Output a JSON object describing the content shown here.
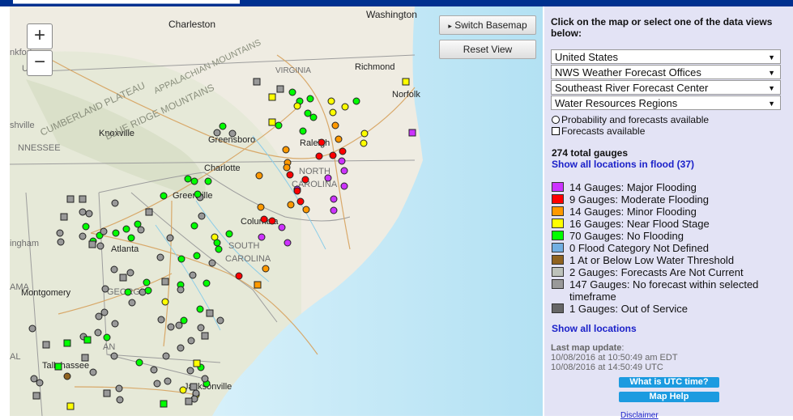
{
  "header": {
    "brand_color": "#00308f"
  },
  "map": {
    "colors": {
      "land": "#f2efe6",
      "ocean": "#c8eaf6",
      "roads": "#d7a25e",
      "state_border": "#9d9d9d",
      "text": "#222222"
    },
    "place_labels": [
      "Washington",
      "Charleston",
      "Richmond",
      "Norfolk",
      "Greensboro",
      "Raleigh",
      "Knoxville",
      "Charlotte",
      "Greenville",
      "Columbia",
      "Atlanta",
      "Montgomery",
      "Tallahassee",
      "Jacksonville",
      "NORTH",
      "CAROLINA",
      "SOUTH",
      "CAROLINA",
      "GEORGIA",
      "VIRGINIA",
      "CUMBERLAND PLATEAU",
      "BLUE RIDGE MOUNTAINS",
      "APPALACHIAN MOUNTAINS",
      "nkfort",
      "UCKY",
      "shville",
      "NNESSEE",
      "ingham",
      "AMA",
      "AL",
      "AN"
    ],
    "gauges": [
      {
        "cat": "yellow",
        "shape": "circle"
      },
      {
        "cat": "green",
        "shape": "circle"
      },
      {
        "cat": "green",
        "shape": "circle"
      },
      {
        "cat": "yellow",
        "shape": "square"
      },
      {
        "cat": "green",
        "shape": "circle"
      },
      {
        "cat": "yellow",
        "shape": "circle"
      },
      {
        "cat": "green",
        "shape": "circle"
      },
      {
        "cat": "yellow",
        "shape": "circle"
      },
      {
        "cat": "yellow",
        "shape": "circle"
      },
      {
        "cat": "yellow",
        "shape": "circle"
      },
      {
        "cat": "green",
        "shape": "circle"
      },
      {
        "cat": "yellow",
        "shape": "square"
      },
      {
        "cat": "green",
        "shape": "circle"
      },
      {
        "cat": "green",
        "shape": "circle"
      },
      {
        "cat": "green",
        "shape": "circle"
      },
      {
        "cat": "green",
        "shape": "circle"
      },
      {
        "cat": "orange",
        "shape": "circle"
      },
      {
        "cat": "orange",
        "shape": "circle"
      },
      {
        "cat": "red",
        "shape": "circle"
      },
      {
        "cat": "red",
        "shape": "circle"
      },
      {
        "cat": "red",
        "shape": "circle"
      },
      {
        "cat": "yellow",
        "shape": "circle"
      },
      {
        "cat": "yellow",
        "shape": "circle"
      },
      {
        "cat": "gray",
        "shape": "circle"
      },
      {
        "cat": "gray",
        "shape": "circle"
      },
      {
        "cat": "green",
        "shape": "circle"
      },
      {
        "cat": "orange",
        "shape": "circle"
      },
      {
        "cat": "orange",
        "shape": "circle"
      },
      {
        "cat": "orange",
        "shape": "circle"
      },
      {
        "cat": "red",
        "shape": "circle"
      },
      {
        "cat": "red",
        "shape": "circle"
      },
      {
        "cat": "red",
        "shape": "circle"
      },
      {
        "cat": "purple",
        "shape": "circle"
      },
      {
        "cat": "purple",
        "shape": "circle"
      },
      {
        "cat": "purple",
        "shape": "circle"
      },
      {
        "cat": "purple",
        "shape": "circle"
      },
      {
        "cat": "orange",
        "shape": "circle"
      },
      {
        "cat": "purple",
        "shape": "circle"
      },
      {
        "cat": "red",
        "shape": "circle"
      },
      {
        "cat": "red",
        "shape": "circle"
      },
      {
        "cat": "purple",
        "shape": "circle"
      },
      {
        "cat": "orange",
        "shape": "circle"
      },
      {
        "cat": "orange",
        "shape": "circle"
      },
      {
        "cat": "orange",
        "shape": "circle"
      },
      {
        "cat": "red",
        "shape": "circle"
      },
      {
        "cat": "red",
        "shape": "circle"
      },
      {
        "cat": "purple",
        "shape": "circle"
      },
      {
        "cat": "purple",
        "shape": "circle"
      },
      {
        "cat": "purple",
        "shape": "circle"
      },
      {
        "cat": "purple",
        "shape": "circle"
      },
      {
        "cat": "orange",
        "shape": "circle"
      },
      {
        "cat": "red",
        "shape": "circle"
      },
      {
        "cat": "orange",
        "shape": "square"
      },
      {
        "cat": "purple",
        "shape": "square"
      },
      {
        "cat": "yellow",
        "shape": "square"
      },
      {
        "cat": "green",
        "shape": "circle"
      },
      {
        "cat": "green",
        "shape": "circle"
      },
      {
        "cat": "green",
        "shape": "circle"
      },
      {
        "cat": "gray",
        "shape": "circle"
      },
      {
        "cat": "green",
        "shape": "circle"
      },
      {
        "cat": "green",
        "shape": "circle"
      },
      {
        "cat": "green",
        "shape": "circle"
      },
      {
        "cat": "gray",
        "shape": "circle"
      },
      {
        "cat": "green",
        "shape": "circle"
      },
      {
        "cat": "yellow",
        "shape": "circle"
      },
      {
        "cat": "green",
        "shape": "circle"
      },
      {
        "cat": "green",
        "shape": "circle"
      },
      {
        "cat": "green",
        "shape": "circle"
      },
      {
        "cat": "gray",
        "shape": "circle"
      },
      {
        "cat": "green",
        "shape": "circle"
      },
      {
        "cat": "green",
        "shape": "circle"
      },
      {
        "cat": "green",
        "shape": "circle"
      },
      {
        "cat": "green",
        "shape": "circle"
      },
      {
        "cat": "gray",
        "shape": "circle"
      },
      {
        "cat": "gray",
        "shape": "square"
      },
      {
        "cat": "gray",
        "shape": "square"
      },
      {
        "cat": "gray",
        "shape": "circle"
      },
      {
        "cat": "gray",
        "shape": "circle"
      },
      {
        "cat": "gray",
        "shape": "circle"
      },
      {
        "cat": "gray",
        "shape": "square"
      },
      {
        "cat": "gray",
        "shape": "circle"
      },
      {
        "cat": "green",
        "shape": "circle"
      },
      {
        "cat": "green",
        "shape": "circle"
      },
      {
        "cat": "green",
        "shape": "circle"
      },
      {
        "cat": "gray",
        "shape": "circle"
      },
      {
        "cat": "gray",
        "shape": "circle"
      },
      {
        "cat": "green",
        "shape": "circle"
      },
      {
        "cat": "green",
        "shape": "circle"
      },
      {
        "cat": "gray",
        "shape": "circle"
      },
      {
        "cat": "gray",
        "shape": "square"
      },
      {
        "cat": "gray",
        "shape": "square"
      },
      {
        "cat": "gray",
        "shape": "circle"
      },
      {
        "cat": "gray",
        "shape": "circle"
      },
      {
        "cat": "gray",
        "shape": "square"
      },
      {
        "cat": "gray",
        "shape": "circle"
      },
      {
        "cat": "green",
        "shape": "circle"
      },
      {
        "cat": "gray",
        "shape": "circle"
      },
      {
        "cat": "gray",
        "shape": "circle"
      },
      {
        "cat": "gray",
        "shape": "circle"
      },
      {
        "cat": "gray",
        "shape": "circle"
      },
      {
        "cat": "gray",
        "shape": "circle"
      },
      {
        "cat": "gray",
        "shape": "circle"
      },
      {
        "cat": "green",
        "shape": "circle"
      },
      {
        "cat": "green",
        "shape": "circle"
      },
      {
        "cat": "gray",
        "shape": "circle"
      },
      {
        "cat": "gray",
        "shape": "circle"
      },
      {
        "cat": "green",
        "shape": "circle"
      },
      {
        "cat": "gray",
        "shape": "circle"
      },
      {
        "cat": "green",
        "shape": "circle"
      },
      {
        "cat": "green",
        "shape": "circle"
      },
      {
        "cat": "gray",
        "shape": "circle"
      },
      {
        "cat": "gray",
        "shape": "circle"
      },
      {
        "cat": "gray",
        "shape": "circle"
      },
      {
        "cat": "gray",
        "shape": "circle"
      },
      {
        "cat": "gray",
        "shape": "circle"
      },
      {
        "cat": "gray",
        "shape": "circle"
      },
      {
        "cat": "green",
        "shape": "circle"
      },
      {
        "cat": "yellow",
        "shape": "circle"
      },
      {
        "cat": "gray",
        "shape": "circle"
      },
      {
        "cat": "gray",
        "shape": "square"
      },
      {
        "cat": "gray",
        "shape": "circle"
      },
      {
        "cat": "gray",
        "shape": "square"
      },
      {
        "cat": "gray",
        "shape": "square"
      },
      {
        "cat": "gray",
        "shape": "circle"
      },
      {
        "cat": "gray",
        "shape": "circle"
      },
      {
        "cat": "gray",
        "shape": "circle"
      },
      {
        "cat": "green",
        "shape": "circle"
      },
      {
        "cat": "gray",
        "shape": "circle"
      },
      {
        "cat": "gray",
        "shape": "circle"
      },
      {
        "cat": "gray",
        "shape": "circle"
      },
      {
        "cat": "gray",
        "shape": "circle"
      },
      {
        "cat": "green",
        "shape": "square"
      },
      {
        "cat": "green",
        "shape": "square"
      },
      {
        "cat": "gray",
        "shape": "square"
      },
      {
        "cat": "gray",
        "shape": "circle"
      },
      {
        "cat": "gray",
        "shape": "square"
      },
      {
        "cat": "gray",
        "shape": "circle"
      },
      {
        "cat": "gray",
        "shape": "circle"
      },
      {
        "cat": "gray",
        "shape": "square"
      },
      {
        "cat": "green",
        "shape": "square"
      },
      {
        "cat": "gray",
        "shape": "square"
      },
      {
        "cat": "gray",
        "shape": "circle"
      },
      {
        "cat": "gray",
        "shape": "circle"
      },
      {
        "cat": "brown",
        "shape": "circle"
      },
      {
        "cat": "yellow",
        "shape": "circle"
      },
      {
        "cat": "gray",
        "shape": "circle"
      },
      {
        "cat": "green",
        "shape": "circle"
      },
      {
        "cat": "gray",
        "shape": "square"
      },
      {
        "cat": "green",
        "shape": "circle"
      },
      {
        "cat": "gray",
        "shape": "circle"
      },
      {
        "cat": "yellow",
        "shape": "circle"
      },
      {
        "cat": "gray",
        "shape": "circle"
      },
      {
        "cat": "gray",
        "shape": "circle"
      },
      {
        "cat": "yellow",
        "shape": "square"
      },
      {
        "cat": "gray",
        "shape": "square"
      },
      {
        "cat": "yellow",
        "shape": "square"
      },
      {
        "cat": "green",
        "shape": "square"
      },
      {
        "cat": "gray",
        "shape": "circle"
      },
      {
        "cat": "gray",
        "shape": "square"
      },
      {
        "cat": "gray",
        "shape": "square"
      }
    ]
  },
  "controls": {
    "zoom_in": "+",
    "zoom_out": "−",
    "switch_basemap": "Switch Basemap",
    "switch_arrow": "▸",
    "reset_view": "Reset View"
  },
  "panel": {
    "instructions": "Click on the map or select one of the data views below:",
    "selects": [
      {
        "value": "United States"
      },
      {
        "value": "NWS Weather Forecast Offices"
      },
      {
        "value": "Southeast River Forecast Center"
      },
      {
        "value": "Water Resources Regions"
      }
    ],
    "select_arrow": "▼",
    "key_prob": "Probability and forecasts available",
    "key_fcst": "Forecasts available",
    "total": "274 total gauges",
    "show_flood": "Show all locations in flood (37)",
    "legend": [
      {
        "label": "14 Gauges: Major Flooding",
        "color": "#cc33ff"
      },
      {
        "label": "9 Gauges: Moderate Flooding",
        "color": "#ff0000"
      },
      {
        "label": "14 Gauges: Minor Flooding",
        "color": "#ff9900"
      },
      {
        "label": "16 Gauges: Near Flood Stage",
        "color": "#ffff00"
      },
      {
        "label": "70 Gauges: No Flooding",
        "color": "#00ff00"
      },
      {
        "label": "0 Flood Category Not Defined",
        "color": "#72afe3"
      },
      {
        "label": "1 At or Below Low Water Threshold",
        "color": "#906320"
      },
      {
        "label": "2 Gauges: Forecasts Are Not Current",
        "color": "#bdc2bb"
      },
      {
        "label": "147 Gauges: No forecast within selected timeframe",
        "color": "#999999"
      },
      {
        "label": "1 Gauges: Out of Service",
        "color": "#666666"
      }
    ],
    "show_all": "Show all locations",
    "update_label": "Last map update",
    "update_sep": ":",
    "update_edt": "10/08/2016 at 10:50:49 am EDT",
    "update_utc": "10/08/2016 at 14:50:49 UTC",
    "utc_button": "What is UTC time?",
    "help_button": "Map Help",
    "disclaimer": "Disclaimer"
  },
  "category_colors": {
    "purple": "#cc33ff",
    "red": "#ff0000",
    "orange": "#ff9900",
    "yellow": "#ffff00",
    "green": "#00ff00",
    "gray": "#999999",
    "brown": "#906320"
  }
}
